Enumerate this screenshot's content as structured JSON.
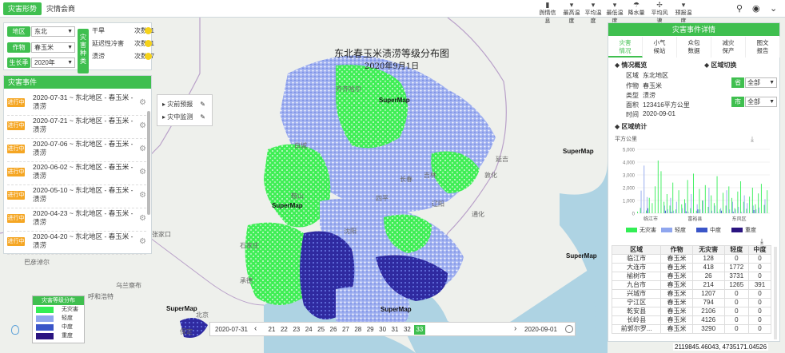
{
  "topbar": {
    "tabs": [
      "灾害形势",
      "灾情会商"
    ],
    "tools": [
      {
        "label": "舆情信息",
        "icon": "bar-chart-icon"
      },
      {
        "label": "最高温度",
        "icon": "thermometer-icon"
      },
      {
        "label": "平均温度",
        "icon": "thermometer-icon"
      },
      {
        "label": "最低温度",
        "icon": "thermometer-icon"
      },
      {
        "label": "降水量",
        "icon": "rain-icon"
      },
      {
        "label": "平均风速",
        "icon": "wind-icon"
      },
      {
        "label": "预报温度",
        "icon": "thermometer-icon"
      }
    ]
  },
  "filters": {
    "region_label": "地区",
    "region_value": "东北",
    "crop_label": "作物",
    "crop_value": "春玉米",
    "season_label": "生长季",
    "season_value": "2020年",
    "badge": "灾害种类",
    "disasters": [
      {
        "name": "干旱",
        "count": "次数: 1"
      },
      {
        "name": "延迟性冷害",
        "count": "次数: 1"
      },
      {
        "name": "渍涝",
        "count": "次数: 7"
      }
    ]
  },
  "events": {
    "header": "灾害事件",
    "items": [
      {
        "tag": "进行中",
        "text": "2020-07-31 ~ 东北地区 - 春玉米 - 渍涝"
      },
      {
        "tag": "进行中",
        "text": "2020-07-21 ~ 东北地区 - 春玉米 - 渍涝"
      },
      {
        "tag": "进行中",
        "text": "2020-07-06 ~ 东北地区 - 春玉米 - 渍涝"
      },
      {
        "tag": "进行中",
        "text": "2020-06-02 ~ 东北地区 - 春玉米 - 渍涝"
      },
      {
        "tag": "进行中",
        "text": "2020-05-10 ~ 东北地区 - 春玉米 - 渍涝"
      },
      {
        "tag": "进行中",
        "text": "2020-04-23 ~ 东北地区 - 春玉米 - 渍涝"
      },
      {
        "tag": "进行中",
        "text": "2020-04-20 ~ 东北地区 - 春玉米 - 渍涝"
      }
    ]
  },
  "menu": {
    "items": [
      "灾前预报",
      "灾中监测"
    ]
  },
  "map": {
    "title": "东北春玉米渍涝等级分布图",
    "subtitle": "2020年9月1日",
    "watermark": "SuperMap",
    "labels": [
      "巴彦淖尔",
      "呼和浩特",
      "乌兰察布",
      "北京",
      "保定",
      "辽阳",
      "鞍山",
      "吉林",
      "通化",
      "敦化",
      "白城",
      "延吉",
      "齐齐哈尔",
      "四平",
      "长春",
      "沈阳",
      "承德",
      "张家口",
      "石家庄"
    ]
  },
  "legend": {
    "title": "灾害等级分布",
    "items": [
      {
        "label": "无灾害",
        "color": "#33ee55"
      },
      {
        "label": "轻度",
        "color": "#8fa6ee"
      },
      {
        "label": "中度",
        "color": "#3a55c8"
      },
      {
        "label": "重度",
        "color": "#2a1480"
      }
    ]
  },
  "timeline": {
    "start": "2020-07-31",
    "end": "2020-09-01",
    "ticks": [
      "21",
      "22",
      "23",
      "24",
      "25",
      "26",
      "27",
      "28",
      "29",
      "30",
      "31",
      "32",
      "33"
    ],
    "active": "33"
  },
  "coords": "2119845.46043, 4735171.04526",
  "detail": {
    "header": "灾害事件详情",
    "tabs": [
      "灾害\n情况",
      "小气\n候站",
      "众包\n数据",
      "减灾\n保产",
      "图文\n报告"
    ],
    "overview_title": "情况概览",
    "switch_title": "区域切换",
    "kv": [
      {
        "k": "区域",
        "v": "东北地区"
      },
      {
        "k": "作物",
        "v": "春玉米"
      },
      {
        "k": "类型",
        "v": "渍涝"
      },
      {
        "k": "面积",
        "v": "123416平方公里"
      },
      {
        "k": "时间",
        "v": "2020-09-01"
      }
    ],
    "province_label": "省",
    "province_value": "全部",
    "city_label": "市",
    "city_value": "全部",
    "stats_title": "区域统计"
  },
  "chart_data": {
    "type": "bar",
    "ylabel": "平方公里",
    "ylim": [
      0,
      5000
    ],
    "yticks": [
      "5,000",
      "4,000",
      "3,000",
      "2,000",
      "1,000",
      "0"
    ],
    "xticks": [
      "临江市",
      "富裕县",
      "东风区"
    ],
    "series": [
      {
        "name": "无灾害",
        "color": "#33ee55"
      },
      {
        "name": "轻度",
        "color": "#8fa6ee"
      },
      {
        "name": "中度",
        "color": "#3a55c8"
      },
      {
        "name": "重度",
        "color": "#2a1480"
      }
    ],
    "bars": [
      [
        128,
        0,
        0,
        0
      ],
      [
        418,
        1772,
        0,
        0
      ],
      [
        26,
        3731,
        0,
        0
      ],
      [
        214,
        1265,
        391,
        0
      ],
      [
        1207,
        0,
        0,
        0
      ],
      [
        794,
        0,
        0,
        0
      ],
      [
        2106,
        0,
        0,
        0
      ],
      [
        4126,
        0,
        0,
        0
      ],
      [
        3290,
        0,
        0,
        0
      ],
      [
        900,
        600,
        200,
        0
      ],
      [
        1500,
        300,
        0,
        0
      ],
      [
        600,
        1200,
        100,
        0
      ],
      [
        2400,
        200,
        0,
        0
      ],
      [
        300,
        900,
        0,
        0
      ],
      [
        1800,
        0,
        0,
        0
      ],
      [
        700,
        400,
        0,
        0
      ],
      [
        1100,
        800,
        150,
        0
      ],
      [
        2600,
        100,
        0,
        0
      ],
      [
        400,
        1500,
        0,
        0
      ],
      [
        3100,
        0,
        0,
        0
      ],
      [
        200,
        700,
        300,
        0
      ],
      [
        1900,
        300,
        0,
        0
      ],
      [
        1000,
        1000,
        0,
        0
      ],
      [
        2200,
        0,
        0,
        0
      ],
      [
        500,
        2000,
        0,
        0
      ],
      [
        1400,
        200,
        0,
        0
      ],
      [
        800,
        600,
        0,
        0
      ],
      [
        2900,
        100,
        0,
        0
      ],
      [
        300,
        400,
        200,
        0
      ],
      [
        1600,
        0,
        0,
        0
      ],
      [
        600,
        1800,
        0,
        0
      ],
      [
        2100,
        300,
        0,
        0
      ],
      [
        1200,
        900,
        100,
        0
      ],
      [
        400,
        300,
        0,
        0
      ],
      [
        1700,
        500,
        0,
        0
      ],
      [
        2500,
        100,
        0,
        0
      ],
      [
        900,
        1400,
        0,
        0
      ],
      [
        350,
        800,
        0,
        0
      ],
      [
        1300,
        0,
        0,
        0
      ],
      [
        2000,
        600,
        250,
        0
      ],
      [
        700,
        300,
        0,
        0
      ],
      [
        1550,
        450,
        0,
        0
      ],
      [
        2300,
        0,
        0,
        0
      ],
      [
        650,
        1100,
        0,
        0
      ],
      [
        1800,
        0,
        0,
        0
      ]
    ]
  },
  "table": {
    "headers": [
      "区域",
      "作物",
      "无灾害",
      "轻度",
      "中度"
    ],
    "rows": [
      [
        "临江市",
        "春玉米",
        "128",
        "0",
        "0"
      ],
      [
        "大连市",
        "春玉米",
        "418",
        "1772",
        "0"
      ],
      [
        "榆树市",
        "春玉米",
        "26",
        "3731",
        "0"
      ],
      [
        "九台市",
        "春玉米",
        "214",
        "1265",
        "391"
      ],
      [
        "兴城市",
        "春玉米",
        "1207",
        "0",
        "0"
      ],
      [
        "宁江区",
        "春玉米",
        "794",
        "0",
        "0"
      ],
      [
        "乾安县",
        "春玉米",
        "2106",
        "0",
        "0"
      ],
      [
        "长岭县",
        "春玉米",
        "4126",
        "0",
        "0"
      ],
      [
        "前郭尔罗...",
        "春玉米",
        "3290",
        "0",
        "0"
      ]
    ]
  }
}
